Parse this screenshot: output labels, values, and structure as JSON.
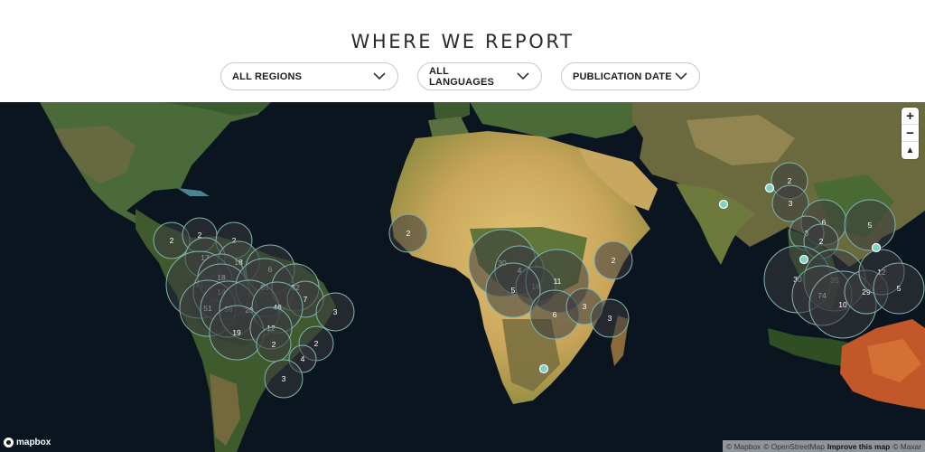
{
  "header": {
    "title": "WHERE WE REPORT",
    "filters": [
      {
        "label": "ALL REGIONS",
        "icon": "chevron-down-icon"
      },
      {
        "label": "ALL LANGUAGES",
        "icon": "chevron-down-icon"
      },
      {
        "label": "PUBLICATION DATE",
        "icon": "chevron-down-icon"
      }
    ]
  },
  "map": {
    "clusters": [
      {
        "label": "2"
      },
      {
        "label": "2"
      },
      {
        "label": "2"
      },
      {
        "label": "17"
      },
      {
        "label": "18"
      },
      {
        "label": "6"
      },
      {
        "label": "71"
      },
      {
        "label": "18"
      },
      {
        "label": "14"
      },
      {
        "label": "95"
      },
      {
        "label": "32"
      },
      {
        "label": "7"
      },
      {
        "label": "51"
      },
      {
        "label": "38"
      },
      {
        "label": "20"
      },
      {
        "label": "46"
      },
      {
        "label": "3"
      },
      {
        "label": "19"
      },
      {
        "label": "12"
      },
      {
        "label": "2"
      },
      {
        "label": "2"
      },
      {
        "label": "4"
      },
      {
        "label": "3"
      },
      {
        "label": "2"
      },
      {
        "label": "30"
      },
      {
        "label": "4"
      },
      {
        "label": "16"
      },
      {
        "label": "11"
      },
      {
        "label": "5"
      },
      {
        "label": "6"
      },
      {
        "label": "3"
      },
      {
        "label": "3"
      },
      {
        "label": "2"
      },
      {
        "label": "2"
      },
      {
        "label": "3"
      },
      {
        "label": "6"
      },
      {
        "label": "5"
      },
      {
        "label": "3"
      },
      {
        "label": "2"
      },
      {
        "label": "30"
      },
      {
        "label": "35"
      },
      {
        "label": "74"
      },
      {
        "label": "10"
      },
      {
        "label": "29"
      },
      {
        "label": "12"
      },
      {
        "label": "5"
      }
    ],
    "zoom_in": "+",
    "zoom_out": "−",
    "compass": "compass-icon",
    "logo_text": "mapbox",
    "attribution": {
      "mapbox": "© Mapbox",
      "osm": "© OpenStreetMap",
      "improve": "Improve this map",
      "maxar": "© Maxar"
    }
  },
  "colors": {
    "ocean": "#0b1520",
    "cluster_fill": "#3a3a3e",
    "cluster_stroke": "#7fb6ad",
    "point_fill": "#7fd3c4"
  }
}
